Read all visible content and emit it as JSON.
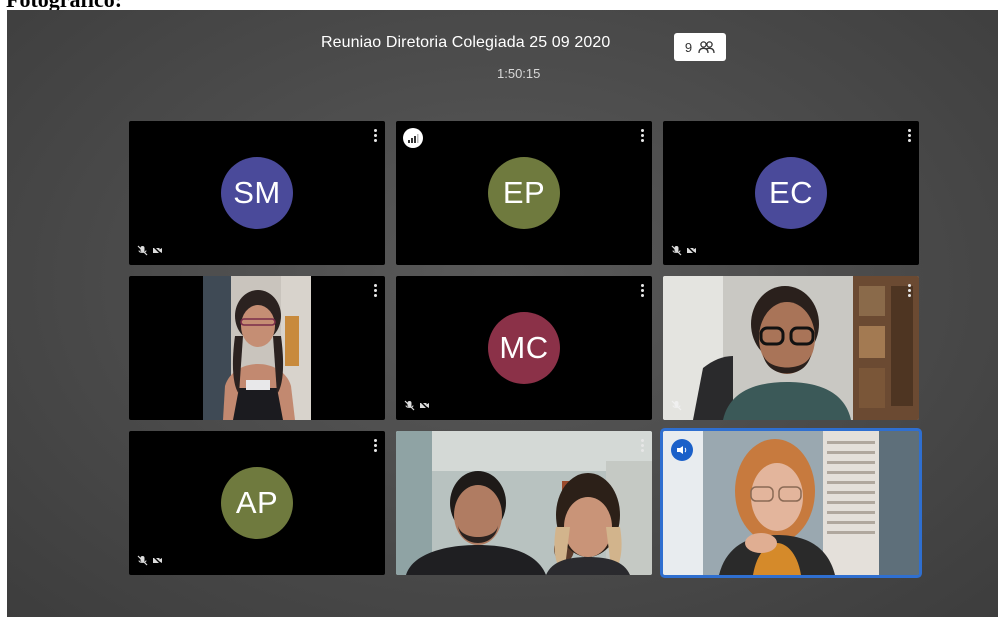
{
  "document": {
    "heading": "Fotográfico:"
  },
  "meeting": {
    "title": "Reuniao Diretoria Colegiada 25 09 2020",
    "timer": "1:50:15",
    "participant_count": "9"
  },
  "colors": {
    "avatar_purple": "#4a4a9a",
    "avatar_olive": "#6f7a3e",
    "avatar_maroon": "#8b3148",
    "active_border": "#2f6fd0"
  },
  "tiles": [
    {
      "initials": "SM",
      "type": "avatar",
      "muted": true
    },
    {
      "initials": "EP",
      "type": "avatar",
      "muted": false,
      "signal_badge": true
    },
    {
      "initials": "EC",
      "type": "avatar",
      "muted": true
    },
    {
      "type": "video",
      "muted": false
    },
    {
      "initials": "MC",
      "type": "avatar",
      "muted": true
    },
    {
      "type": "video",
      "muted": true
    },
    {
      "initials": "AP",
      "type": "avatar",
      "muted": true
    },
    {
      "type": "video",
      "muted": false
    },
    {
      "type": "video",
      "muted": false,
      "active_speaker": true
    }
  ]
}
